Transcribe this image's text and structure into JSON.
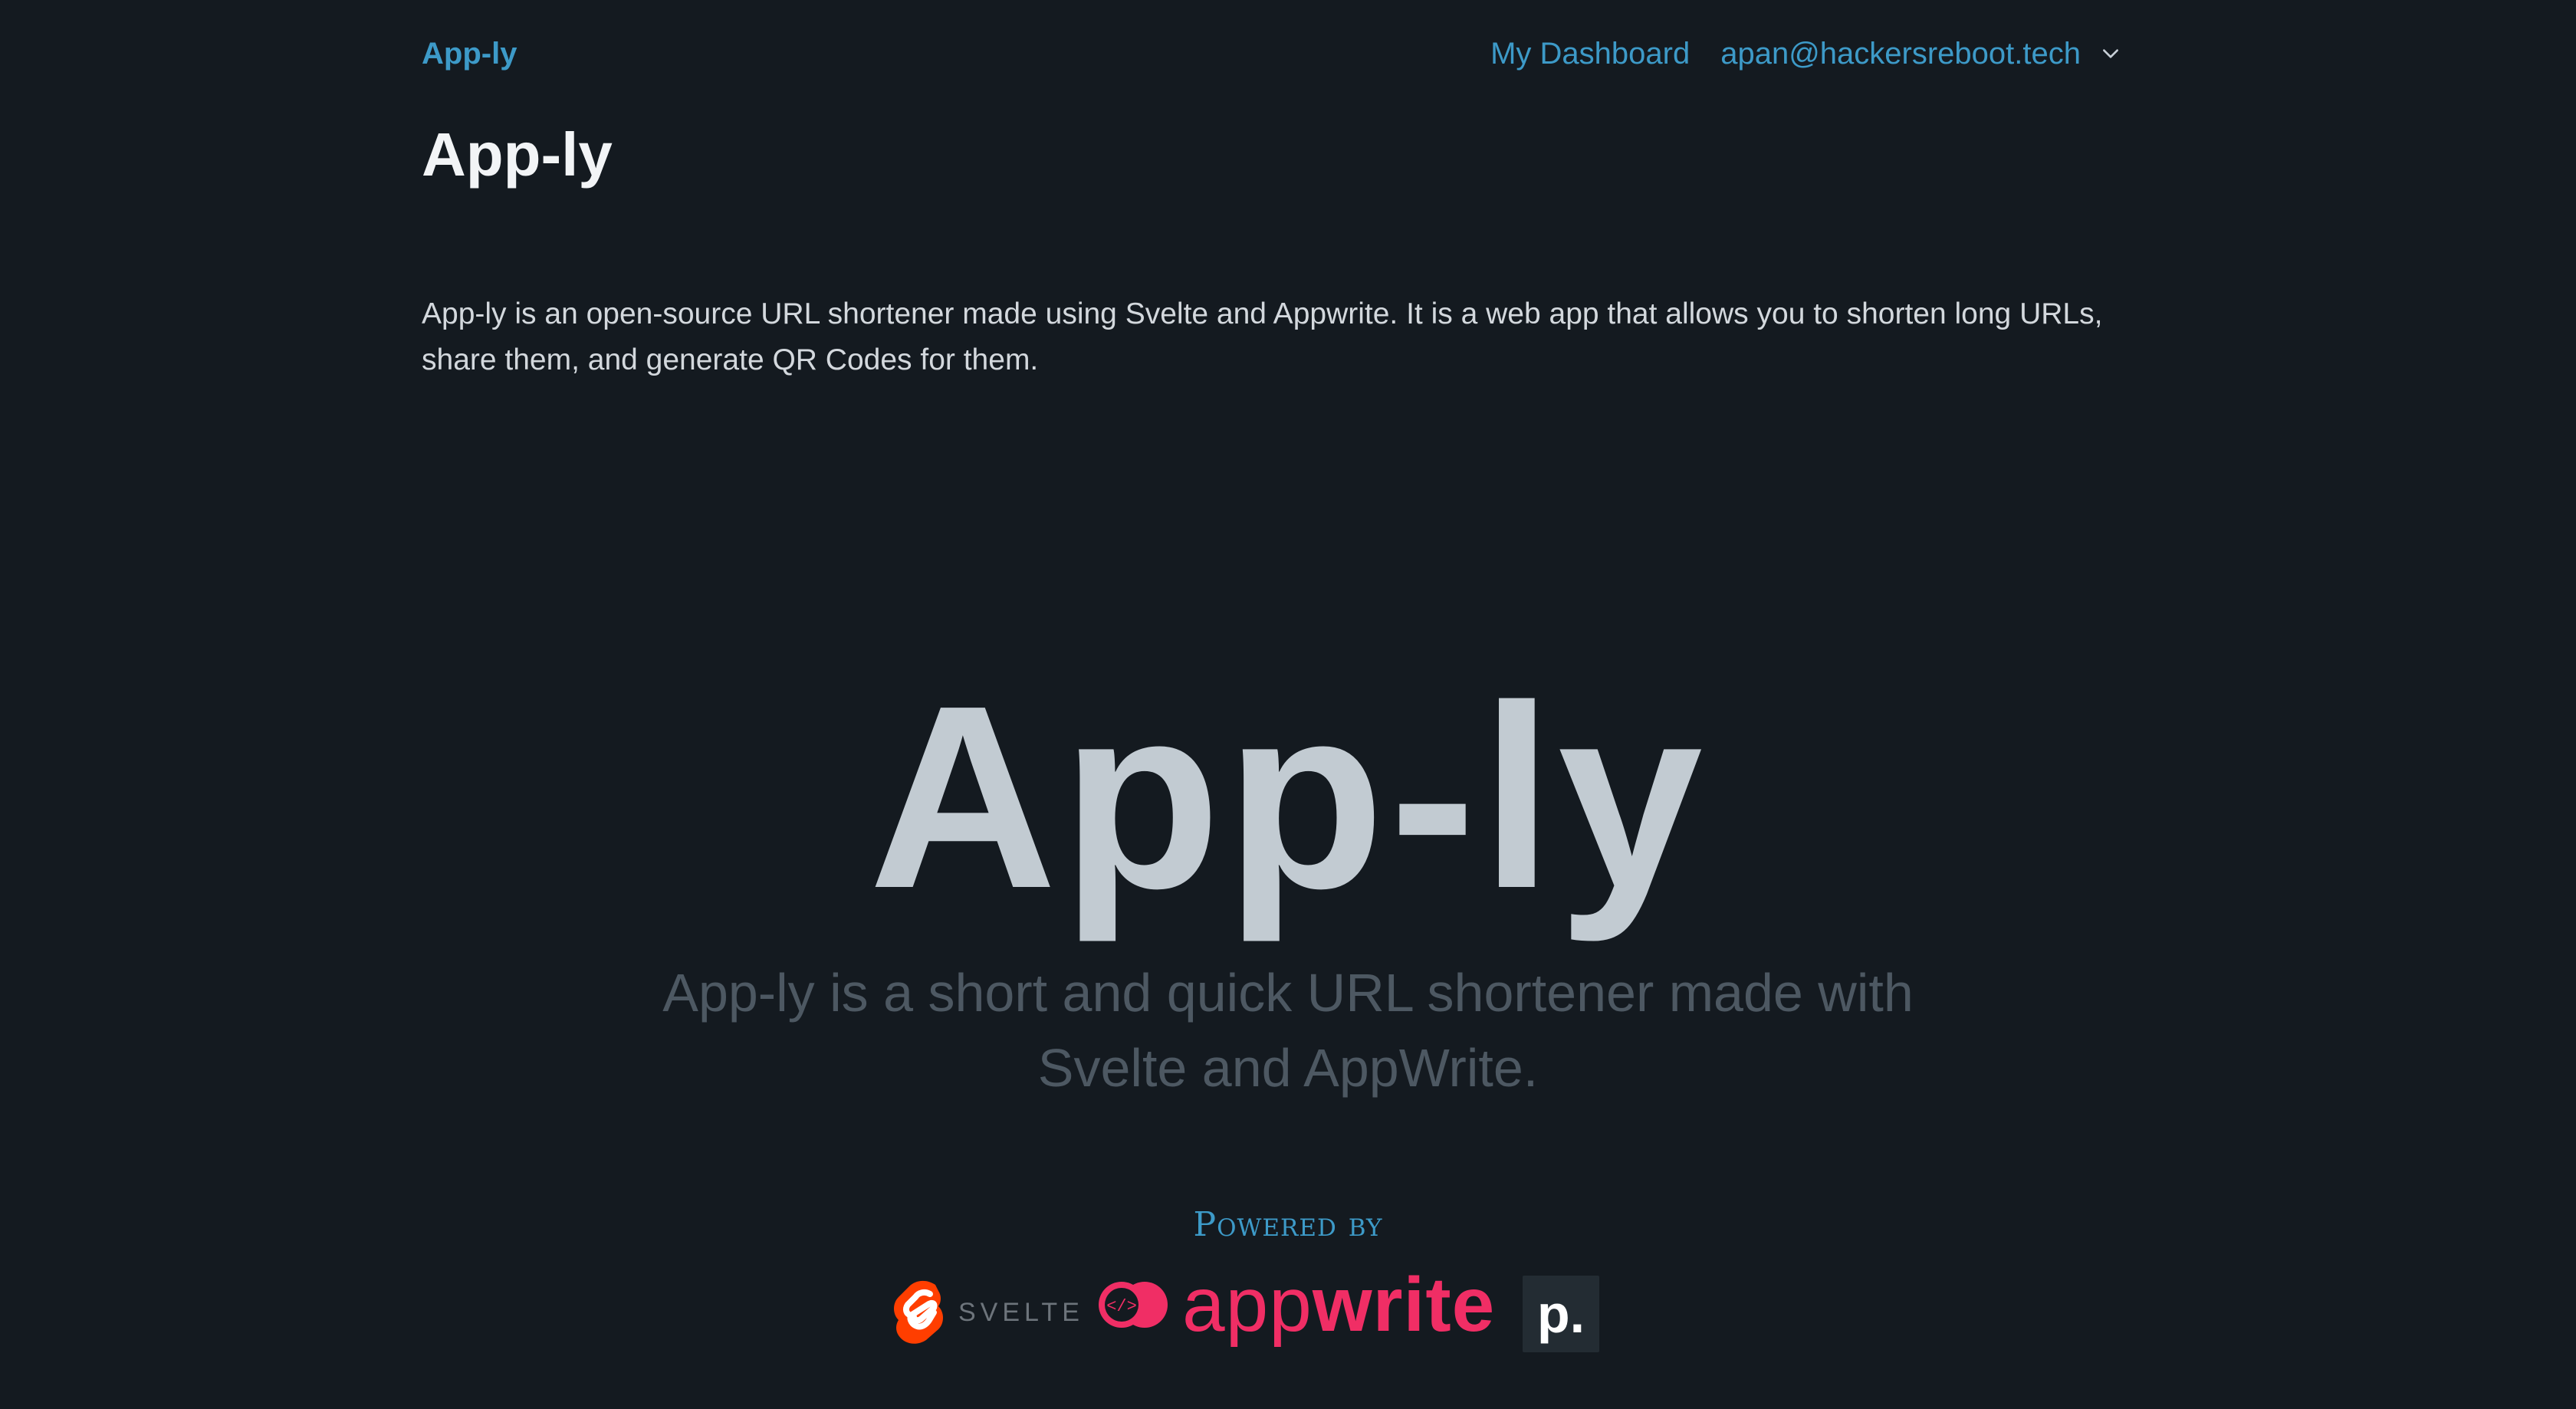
{
  "header": {
    "brand": "App-ly",
    "dashboard_link": "My Dashboard",
    "user_email": "apan@hackersreboot.tech",
    "user_menu_icon": "chevron-down-icon"
  },
  "main": {
    "title": "App-ly",
    "description": "App-ly is an open-source URL shortener made using Svelte and Appwrite. It is a web app that allows you to shorten long URLs, share them, and generate QR Codes for them."
  },
  "hero": {
    "title": "App-ly",
    "subtitle": "App-ly is a short and quick URL shortener made with Svelte and AppWrite."
  },
  "powered_by": {
    "label": "Powered by",
    "logos": [
      {
        "name": "svelte",
        "text": "SVELTE",
        "color": "#ff3e00"
      },
      {
        "name": "appwrite",
        "text_regular": "app",
        "text_bold": "write",
        "color": "#f02e65"
      },
      {
        "name": "pipedream",
        "text": "p.",
        "color": "#232c33"
      }
    ]
  },
  "colors": {
    "background": "#141a20",
    "accent": "#3d9ac8",
    "hero_text": "#c2cbd2",
    "subtitle_text": "#4d5862"
  }
}
